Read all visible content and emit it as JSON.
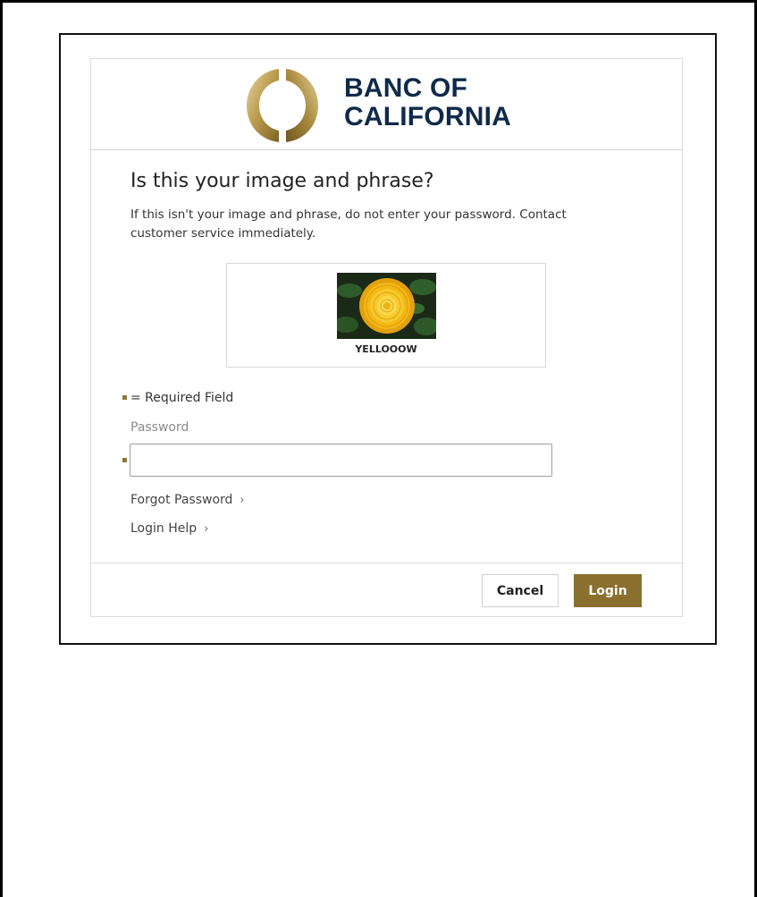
{
  "brand": {
    "line1": "BANC OF",
    "line2": "CALIFORNIA",
    "logo_icon": "ring-logo-icon",
    "brand_color": "#0f2a4a",
    "gold_color": "#b89b4a"
  },
  "challenge": {
    "title": "Is this your image and phrase?",
    "warning": "If this isn't your image and phrase, do not enter your password. Contact customer service immediately.",
    "image_icon": "yellow-flower-image",
    "phrase": "YELLOOOW"
  },
  "form": {
    "required_note": "= Required Field",
    "password_label": "Password",
    "password_value": "",
    "required_marker_color": "#8a7a3b"
  },
  "links": {
    "forgot_password": "Forgot Password",
    "login_help": "Login Help",
    "chevron": "›"
  },
  "actions": {
    "cancel": "Cancel",
    "login": "Login",
    "login_color": "#8a6f2e"
  }
}
